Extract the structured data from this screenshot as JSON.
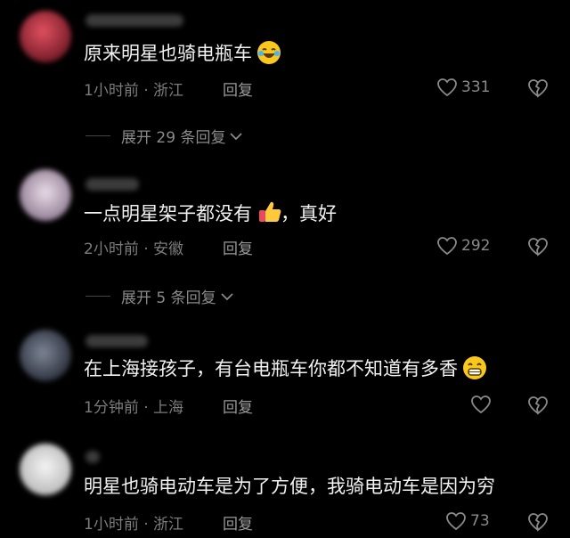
{
  "comments": [
    {
      "text": "原来明星也骑电瓶车",
      "meta": "1小时前 · 浙江",
      "reply": "回复",
      "likes": "331",
      "expand": "展开 29 条回复",
      "emoji": "laughing-tears-emoji",
      "avatar_color": "#b0303a"
    },
    {
      "text": "一点明星架子都没有",
      "text_after": "，真好",
      "meta": "2小时前 · 安徽",
      "reply": "回复",
      "likes": "292",
      "expand": "展开 5 条回复",
      "emoji": "thumbs-up-emoji",
      "avatar_color": "#c9b9c6"
    },
    {
      "text": "在上海接孩子，有台电瓶车你都不知道有多香",
      "meta": "1分钟前 · 上海",
      "reply": "回复",
      "likes": "",
      "emoji": "grinning-emoji",
      "avatar_color": "#5a6170"
    },
    {
      "text": "明星也骑电动车是为了方便，我骑电动车是因为穷",
      "meta": "1小时前 · 浙江",
      "reply": "回复",
      "likes": "73",
      "avatar_color": "#dcdcdc"
    }
  ]
}
